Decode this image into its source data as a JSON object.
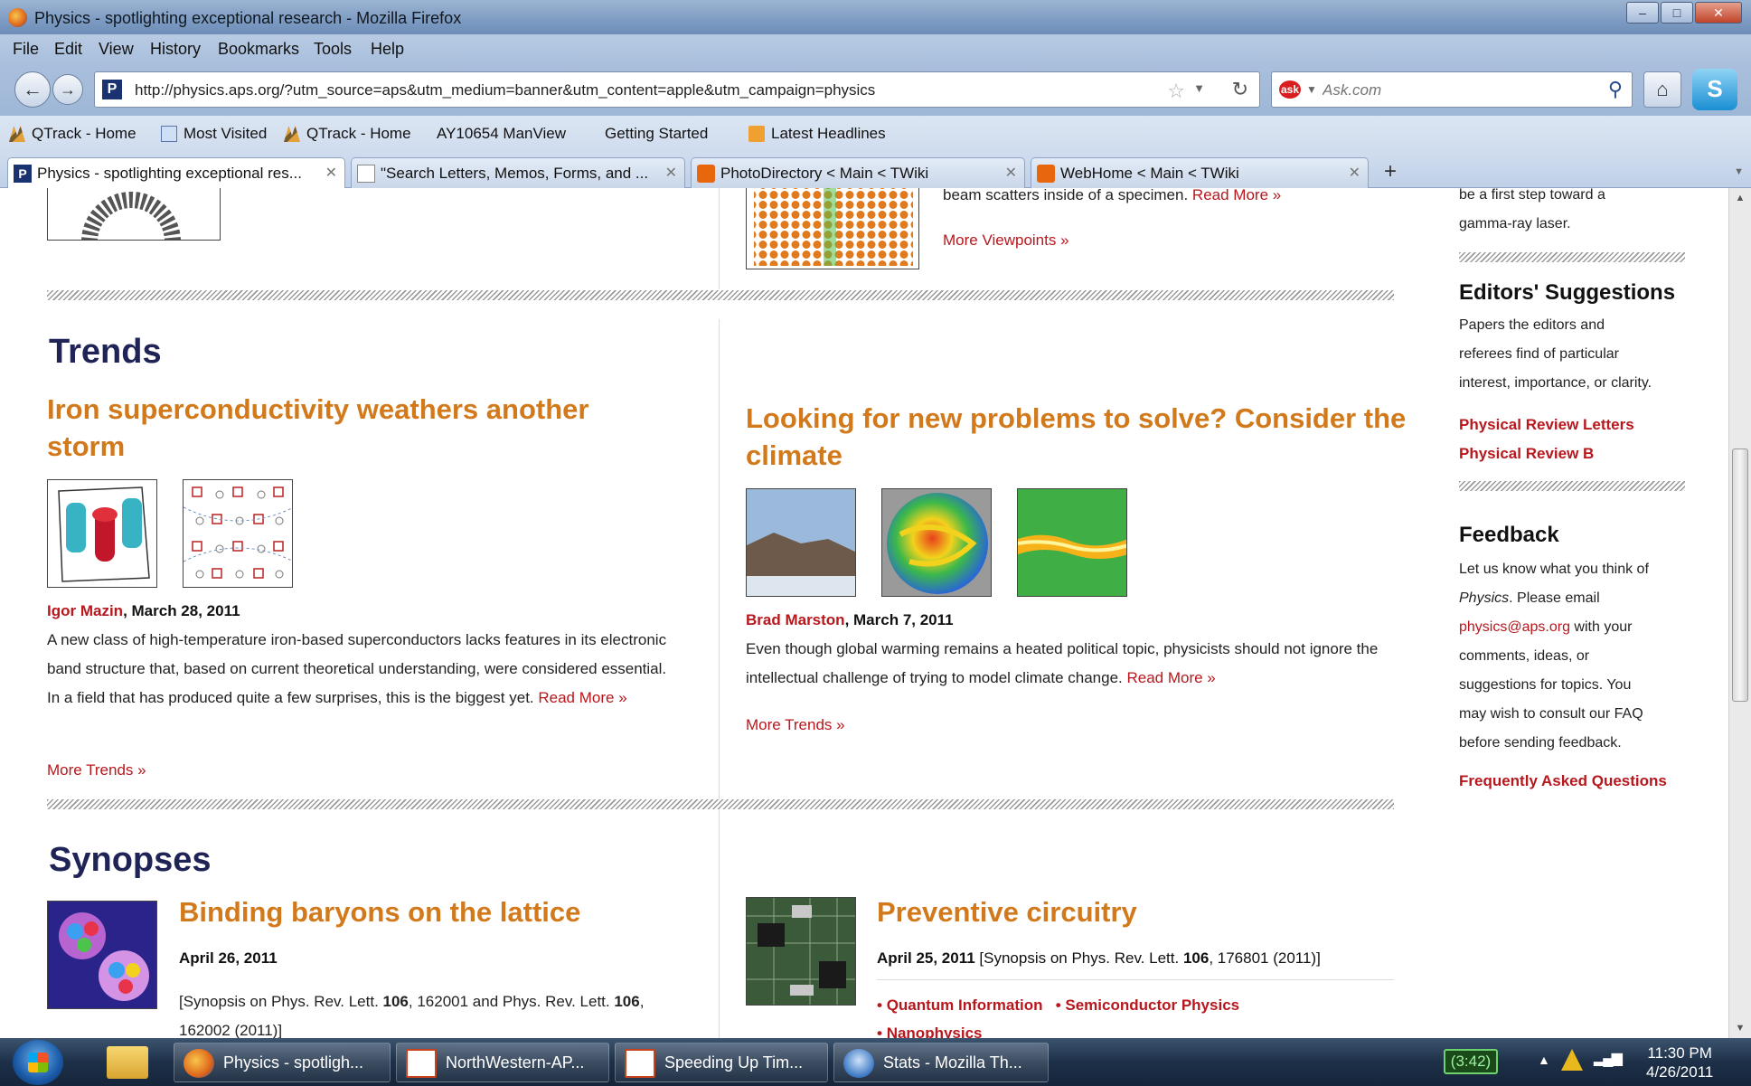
{
  "window": {
    "title": "Physics - spotlighting exceptional research - Mozilla Firefox",
    "controls": [
      "–",
      "□",
      "✕"
    ]
  },
  "menu": [
    "File",
    "Edit",
    "View",
    "History",
    "Bookmarks",
    "Tools",
    "Help"
  ],
  "navigation": {
    "back": "←",
    "forward": "→",
    "url": "http://physics.aps.org/?utm_source=aps&utm_medium=banner&utm_content=apple&utm_campaign=physics",
    "search_placeholder": "Ask.com",
    "site_icon_letter": "P"
  },
  "bookmarks": [
    {
      "label": "QTrack - Home",
      "icon": "qtrack-icon"
    },
    {
      "label": "Most Visited",
      "icon": "most-visited-icon"
    },
    {
      "label": "QTrack - Home",
      "icon": "qtrack-icon"
    },
    {
      "label": "AY10654 ManView",
      "icon": "page-icon"
    },
    {
      "label": "Getting Started",
      "icon": "page-icon"
    },
    {
      "label": "Latest Headlines",
      "icon": "rss-icon"
    }
  ],
  "tabs": [
    {
      "label": "Physics - spotlighting exceptional res...",
      "active": true,
      "icon": "aps-icon"
    },
    {
      "label": "\"Search Letters, Memos, Forms, and ...",
      "active": false,
      "icon": "document-icon"
    },
    {
      "label": "PhotoDirectory < Main < TWiki",
      "active": false,
      "icon": "twiki-icon"
    },
    {
      "label": "WebHome < Main < TWiki",
      "active": false,
      "icon": "twiki-icon"
    }
  ],
  "content": {
    "viewpoints_snippet_text": "beam scatters inside of a specimen.",
    "read_more": "Read More »",
    "more_viewpoints": "More Viewpoints »",
    "trends": {
      "heading": "Trends",
      "left": {
        "title": "Iron superconductivity weathers another storm",
        "author": "Igor Mazin",
        "date": ", March 28, 2011",
        "body": "A new class of high-temperature iron-based superconductors lacks features in its electronic band structure that, based on current theoretical understanding, were considered essential. In a field that has produced quite a few surprises, this is the biggest yet.",
        "more": "More Trends »"
      },
      "right": {
        "title": "Looking for new problems to solve? Consider the climate",
        "author": "Brad Marston",
        "date": ", March 7, 2011",
        "body": "Even though global warming remains a heated political topic, physicists should not ignore the intellectual challenge of trying to model climate change.",
        "more": "More Trends »"
      }
    },
    "synopses": {
      "heading": "Synopses",
      "left": {
        "title": "Binding baryons on the lattice",
        "date": "April 26, 2011",
        "ref_prefix": "[Synopsis on Phys. Rev. Lett. ",
        "vol1": "106",
        "ref_mid": ", 162001 and Phys. Rev. Lett. ",
        "vol2": "106",
        "ref_end": ", 162002 (2011)]"
      },
      "right": {
        "title": "Preventive circuitry",
        "date": "April 25, 2011",
        "ref_prefix": " [Synopsis on Phys. Rev. Lett. ",
        "vol": "106",
        "ref_end": ", 176801 (2011)]",
        "tags": [
          "Quantum Information",
          "Semiconductor Physics",
          "Nanophysics"
        ]
      }
    }
  },
  "sidebar": {
    "laser_line1": "be a first step toward a",
    "laser_line2": "gamma-ray laser.",
    "editors": {
      "heading": "Editors' Suggestions",
      "lines": [
        "Papers the editors and",
        "referees find of particular",
        "interest, importance, or clarity."
      ],
      "links": [
        "Physical Review Letters",
        "Physical Review B"
      ]
    },
    "feedback": {
      "heading": "Feedback",
      "line1": "Let us know what you think of",
      "physics_italic": "Physics",
      "line2_rest": ". Please email",
      "email": "physics@aps.org",
      "line3_rest": " with your",
      "lines_after": [
        "comments, ideas, or",
        "suggestions for topics. You",
        "may wish to consult our FAQ",
        "before sending feedback."
      ],
      "faq_link": "Frequently Asked Questions"
    }
  },
  "taskbar": {
    "items": [
      {
        "label": "Physics - spotligh...",
        "icon": "firefox-icon"
      },
      {
        "label": "NorthWestern-AP...",
        "icon": "powerpoint-icon"
      },
      {
        "label": "Speeding Up Tim...",
        "icon": "powerpoint-icon"
      },
      {
        "label": "Stats - Mozilla Th...",
        "icon": "thunderbird-icon"
      }
    ],
    "battery": "(3:42)",
    "time": "11:30 PM",
    "date": "4/26/2011"
  }
}
